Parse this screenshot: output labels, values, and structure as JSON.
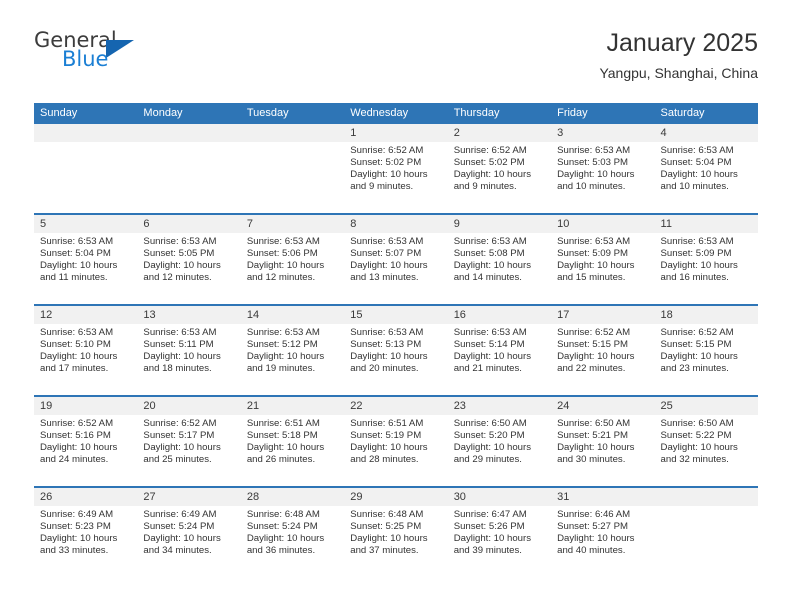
{
  "logo": {
    "word_top": "General",
    "word_bottom": "Blue",
    "accent_color": "#1565b0"
  },
  "header": {
    "title": "January 2025",
    "subtitle": "Yangpu, Shanghai, China"
  },
  "theme": {
    "header_blue": "#2e75b6",
    "date_strip_gray": "#f1f1f1",
    "text_color": "#333333"
  },
  "calendar": {
    "weekdays": [
      "Sunday",
      "Monday",
      "Tuesday",
      "Wednesday",
      "Thursday",
      "Friday",
      "Saturday"
    ],
    "weeks": [
      [
        {
          "day": "",
          "sunrise": "",
          "sunset": "",
          "daylight_line1": "",
          "daylight_line2": ""
        },
        {
          "day": "",
          "sunrise": "",
          "sunset": "",
          "daylight_line1": "",
          "daylight_line2": ""
        },
        {
          "day": "",
          "sunrise": "",
          "sunset": "",
          "daylight_line1": "",
          "daylight_line2": ""
        },
        {
          "day": "1",
          "sunrise": "Sunrise: 6:52 AM",
          "sunset": "Sunset: 5:02 PM",
          "daylight_line1": "Daylight: 10 hours",
          "daylight_line2": "and 9 minutes."
        },
        {
          "day": "2",
          "sunrise": "Sunrise: 6:52 AM",
          "sunset": "Sunset: 5:02 PM",
          "daylight_line1": "Daylight: 10 hours",
          "daylight_line2": "and 9 minutes."
        },
        {
          "day": "3",
          "sunrise": "Sunrise: 6:53 AM",
          "sunset": "Sunset: 5:03 PM",
          "daylight_line1": "Daylight: 10 hours",
          "daylight_line2": "and 10 minutes."
        },
        {
          "day": "4",
          "sunrise": "Sunrise: 6:53 AM",
          "sunset": "Sunset: 5:04 PM",
          "daylight_line1": "Daylight: 10 hours",
          "daylight_line2": "and 10 minutes."
        }
      ],
      [
        {
          "day": "5",
          "sunrise": "Sunrise: 6:53 AM",
          "sunset": "Sunset: 5:04 PM",
          "daylight_line1": "Daylight: 10 hours",
          "daylight_line2": "and 11 minutes."
        },
        {
          "day": "6",
          "sunrise": "Sunrise: 6:53 AM",
          "sunset": "Sunset: 5:05 PM",
          "daylight_line1": "Daylight: 10 hours",
          "daylight_line2": "and 12 minutes."
        },
        {
          "day": "7",
          "sunrise": "Sunrise: 6:53 AM",
          "sunset": "Sunset: 5:06 PM",
          "daylight_line1": "Daylight: 10 hours",
          "daylight_line2": "and 12 minutes."
        },
        {
          "day": "8",
          "sunrise": "Sunrise: 6:53 AM",
          "sunset": "Sunset: 5:07 PM",
          "daylight_line1": "Daylight: 10 hours",
          "daylight_line2": "and 13 minutes."
        },
        {
          "day": "9",
          "sunrise": "Sunrise: 6:53 AM",
          "sunset": "Sunset: 5:08 PM",
          "daylight_line1": "Daylight: 10 hours",
          "daylight_line2": "and 14 minutes."
        },
        {
          "day": "10",
          "sunrise": "Sunrise: 6:53 AM",
          "sunset": "Sunset: 5:09 PM",
          "daylight_line1": "Daylight: 10 hours",
          "daylight_line2": "and 15 minutes."
        },
        {
          "day": "11",
          "sunrise": "Sunrise: 6:53 AM",
          "sunset": "Sunset: 5:09 PM",
          "daylight_line1": "Daylight: 10 hours",
          "daylight_line2": "and 16 minutes."
        }
      ],
      [
        {
          "day": "12",
          "sunrise": "Sunrise: 6:53 AM",
          "sunset": "Sunset: 5:10 PM",
          "daylight_line1": "Daylight: 10 hours",
          "daylight_line2": "and 17 minutes."
        },
        {
          "day": "13",
          "sunrise": "Sunrise: 6:53 AM",
          "sunset": "Sunset: 5:11 PM",
          "daylight_line1": "Daylight: 10 hours",
          "daylight_line2": "and 18 minutes."
        },
        {
          "day": "14",
          "sunrise": "Sunrise: 6:53 AM",
          "sunset": "Sunset: 5:12 PM",
          "daylight_line1": "Daylight: 10 hours",
          "daylight_line2": "and 19 minutes."
        },
        {
          "day": "15",
          "sunrise": "Sunrise: 6:53 AM",
          "sunset": "Sunset: 5:13 PM",
          "daylight_line1": "Daylight: 10 hours",
          "daylight_line2": "and 20 minutes."
        },
        {
          "day": "16",
          "sunrise": "Sunrise: 6:53 AM",
          "sunset": "Sunset: 5:14 PM",
          "daylight_line1": "Daylight: 10 hours",
          "daylight_line2": "and 21 minutes."
        },
        {
          "day": "17",
          "sunrise": "Sunrise: 6:52 AM",
          "sunset": "Sunset: 5:15 PM",
          "daylight_line1": "Daylight: 10 hours",
          "daylight_line2": "and 22 minutes."
        },
        {
          "day": "18",
          "sunrise": "Sunrise: 6:52 AM",
          "sunset": "Sunset: 5:15 PM",
          "daylight_line1": "Daylight: 10 hours",
          "daylight_line2": "and 23 minutes."
        }
      ],
      [
        {
          "day": "19",
          "sunrise": "Sunrise: 6:52 AM",
          "sunset": "Sunset: 5:16 PM",
          "daylight_line1": "Daylight: 10 hours",
          "daylight_line2": "and 24 minutes."
        },
        {
          "day": "20",
          "sunrise": "Sunrise: 6:52 AM",
          "sunset": "Sunset: 5:17 PM",
          "daylight_line1": "Daylight: 10 hours",
          "daylight_line2": "and 25 minutes."
        },
        {
          "day": "21",
          "sunrise": "Sunrise: 6:51 AM",
          "sunset": "Sunset: 5:18 PM",
          "daylight_line1": "Daylight: 10 hours",
          "daylight_line2": "and 26 minutes."
        },
        {
          "day": "22",
          "sunrise": "Sunrise: 6:51 AM",
          "sunset": "Sunset: 5:19 PM",
          "daylight_line1": "Daylight: 10 hours",
          "daylight_line2": "and 28 minutes."
        },
        {
          "day": "23",
          "sunrise": "Sunrise: 6:50 AM",
          "sunset": "Sunset: 5:20 PM",
          "daylight_line1": "Daylight: 10 hours",
          "daylight_line2": "and 29 minutes."
        },
        {
          "day": "24",
          "sunrise": "Sunrise: 6:50 AM",
          "sunset": "Sunset: 5:21 PM",
          "daylight_line1": "Daylight: 10 hours",
          "daylight_line2": "and 30 minutes."
        },
        {
          "day": "25",
          "sunrise": "Sunrise: 6:50 AM",
          "sunset": "Sunset: 5:22 PM",
          "daylight_line1": "Daylight: 10 hours",
          "daylight_line2": "and 32 minutes."
        }
      ],
      [
        {
          "day": "26",
          "sunrise": "Sunrise: 6:49 AM",
          "sunset": "Sunset: 5:23 PM",
          "daylight_line1": "Daylight: 10 hours",
          "daylight_line2": "and 33 minutes."
        },
        {
          "day": "27",
          "sunrise": "Sunrise: 6:49 AM",
          "sunset": "Sunset: 5:24 PM",
          "daylight_line1": "Daylight: 10 hours",
          "daylight_line2": "and 34 minutes."
        },
        {
          "day": "28",
          "sunrise": "Sunrise: 6:48 AM",
          "sunset": "Sunset: 5:24 PM",
          "daylight_line1": "Daylight: 10 hours",
          "daylight_line2": "and 36 minutes."
        },
        {
          "day": "29",
          "sunrise": "Sunrise: 6:48 AM",
          "sunset": "Sunset: 5:25 PM",
          "daylight_line1": "Daylight: 10 hours",
          "daylight_line2": "and 37 minutes."
        },
        {
          "day": "30",
          "sunrise": "Sunrise: 6:47 AM",
          "sunset": "Sunset: 5:26 PM",
          "daylight_line1": "Daylight: 10 hours",
          "daylight_line2": "and 39 minutes."
        },
        {
          "day": "31",
          "sunrise": "Sunrise: 6:46 AM",
          "sunset": "Sunset: 5:27 PM",
          "daylight_line1": "Daylight: 10 hours",
          "daylight_line2": "and 40 minutes."
        },
        {
          "day": "",
          "sunrise": "",
          "sunset": "",
          "daylight_line1": "",
          "daylight_line2": ""
        }
      ]
    ]
  }
}
